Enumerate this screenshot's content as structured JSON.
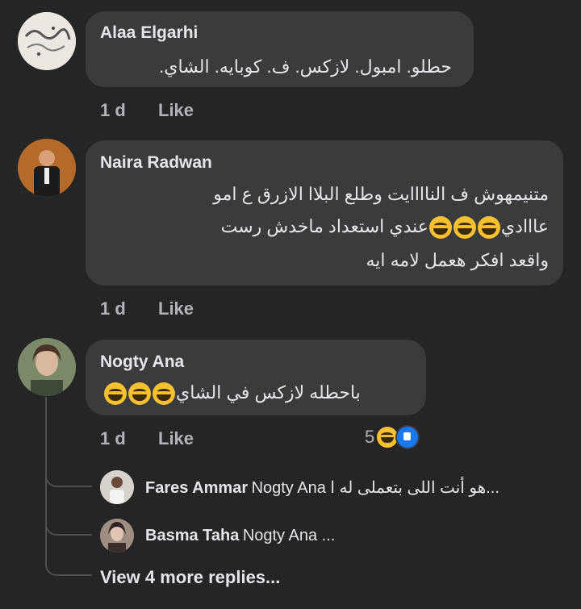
{
  "comments": [
    {
      "author": "Alaa Elgarhi",
      "lines": [
        "حطلو.  امبول. لازكس. ف. كوبايه. الشاي."
      ],
      "time": "1 d",
      "like": "Like"
    },
    {
      "author": "Naira Radwan",
      "line1": "متنيمهوش ف الناااايت وطلع البلاا الازرق ع امو",
      "line2a": "عااادي",
      "line2b": "عندي استعداد ماخدش رست",
      "line3": "واقعد افكر هعمل لامه ايه",
      "time": "1 d",
      "like": "Like"
    },
    {
      "author": "Nogty Ana",
      "line1": "باحطله لازكس في الشاي",
      "time": "1 d",
      "like": "Like",
      "reaction_count": "5"
    }
  ],
  "replies": [
    {
      "author": "Fares Ammar",
      "text": "Nogty Ana هو أنت اللى بتعملى له ا..."
    },
    {
      "author": "Basma Taha",
      "text": "Nogty Ana ..."
    }
  ],
  "more_replies": "View 4 more replies...",
  "colors": {
    "background": "#242526",
    "bubble": "#3a3b3c",
    "like_blue": "#1877f2",
    "haha_yellow": "#f7c02f"
  },
  "icons": [
    "haha-emoji-icon",
    "like-reaction-icon"
  ]
}
